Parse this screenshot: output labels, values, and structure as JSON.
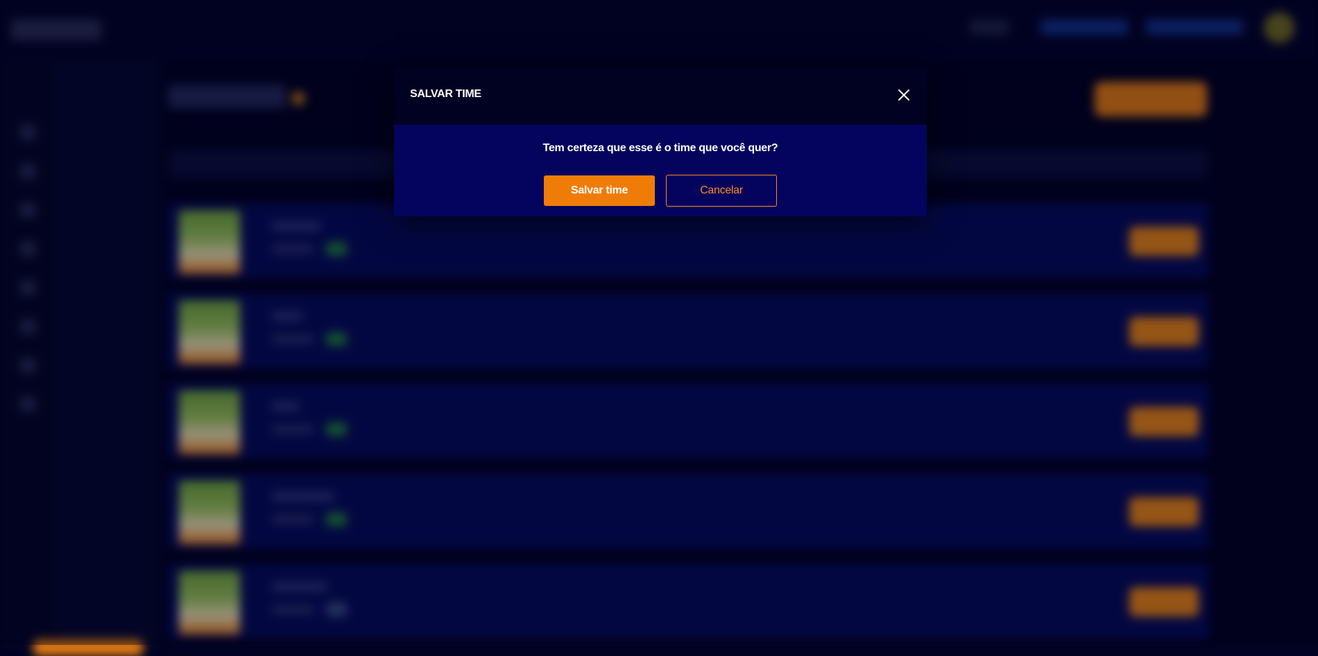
{
  "modal": {
    "title": "SALVAR TIME",
    "question": "Tem certeza que esse é o time que você quer?",
    "confirm_label": "Salvar time",
    "cancel_label": "Cancelar",
    "close_icon": "close-icon"
  },
  "background": {
    "sidebar_icons": [
      "home-icon",
      "trophy-icon",
      "team-icon",
      "calendar-icon",
      "chart-icon",
      "shop-icon",
      "settings-icon",
      "help-icon"
    ],
    "player_rows_visible": 5
  },
  "colors": {
    "accent": "#f07c08",
    "modal_header": "#010122",
    "modal_body": "#04045e",
    "page_background": "#020322"
  }
}
